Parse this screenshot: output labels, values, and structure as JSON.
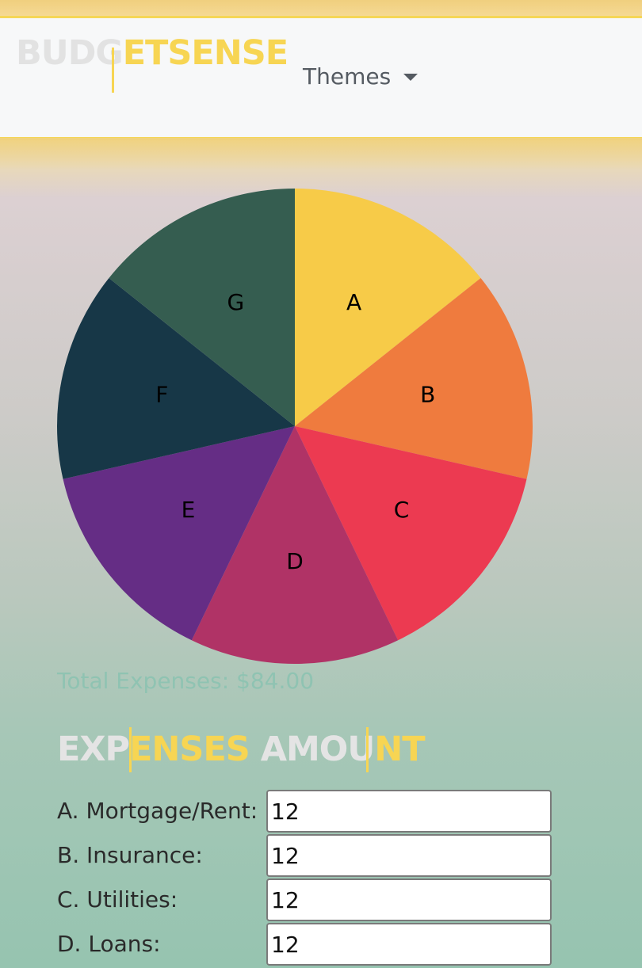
{
  "navbar": {
    "brand_part1": "BUDG",
    "brand_part2": "ETSENSE",
    "themes_label": "Themes"
  },
  "chart_data": {
    "type": "pie",
    "categories": [
      "A",
      "B",
      "C",
      "D",
      "E",
      "F",
      "G"
    ],
    "values": [
      12,
      12,
      12,
      12,
      12,
      12,
      12
    ],
    "colors": [
      "#f7cb48",
      "#ef7b3e",
      "#ec3a51",
      "#b03366",
      "#652d85",
      "#173747",
      "#355d50"
    ],
    "label_color": "#000000"
  },
  "summary": {
    "total_text": "Total Expenses: $84.00"
  },
  "heading": {
    "part1": "EXP",
    "part2": "ENSES",
    "part3": "AMOU",
    "part4": "NT"
  },
  "expenses": [
    {
      "label": "A. Mortgage/Rent:",
      "value": "12"
    },
    {
      "label": "B. Insurance:",
      "value": "12"
    },
    {
      "label": "C. Utilities:",
      "value": "12"
    },
    {
      "label": "D. Loans:",
      "value": "12"
    }
  ],
  "colors": {
    "accent_gold": "#f7d553",
    "heading_grey": "#e4e4e4",
    "total_text": "#8fc3b2"
  }
}
